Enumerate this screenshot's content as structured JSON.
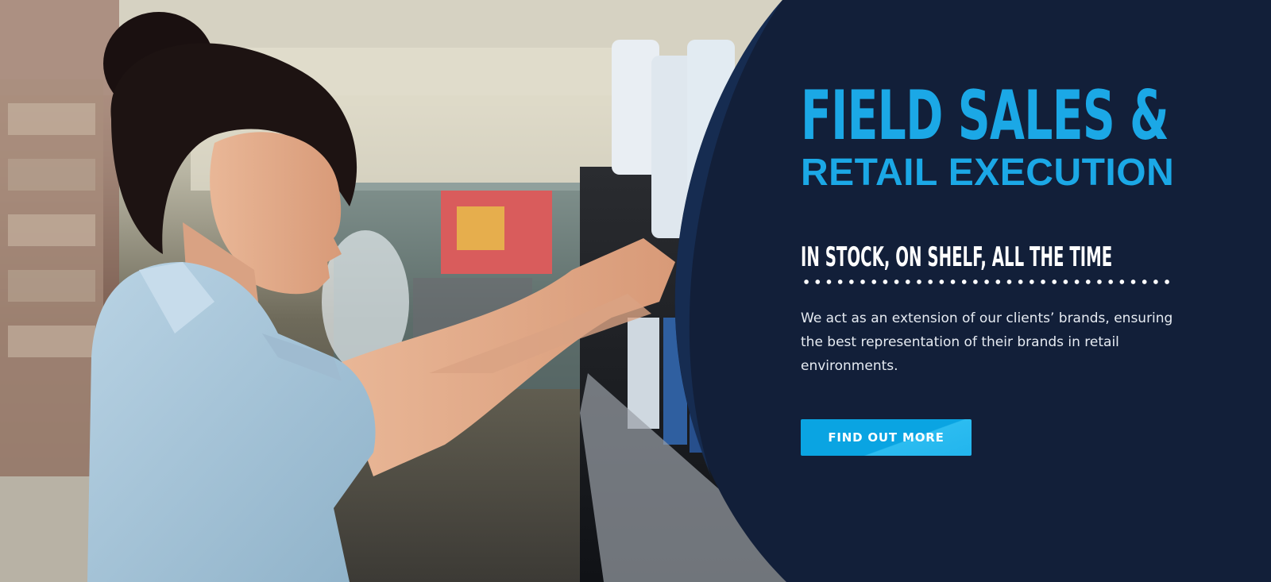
{
  "hero": {
    "title_line1": "FIELD SALES &",
    "title_line2": "RETAIL EXECUTION",
    "tagline": "IN STOCK, ON SHELF, ALL THE TIME",
    "description": "We act as an extension of our clients’ brands, ensuring the best representation of their brands in retail environments.",
    "cta_label": "FIND OUT MORE"
  },
  "colors": {
    "accent": "#1ba8e6",
    "panel": "#121f39",
    "button": "#0aa4e2"
  }
}
